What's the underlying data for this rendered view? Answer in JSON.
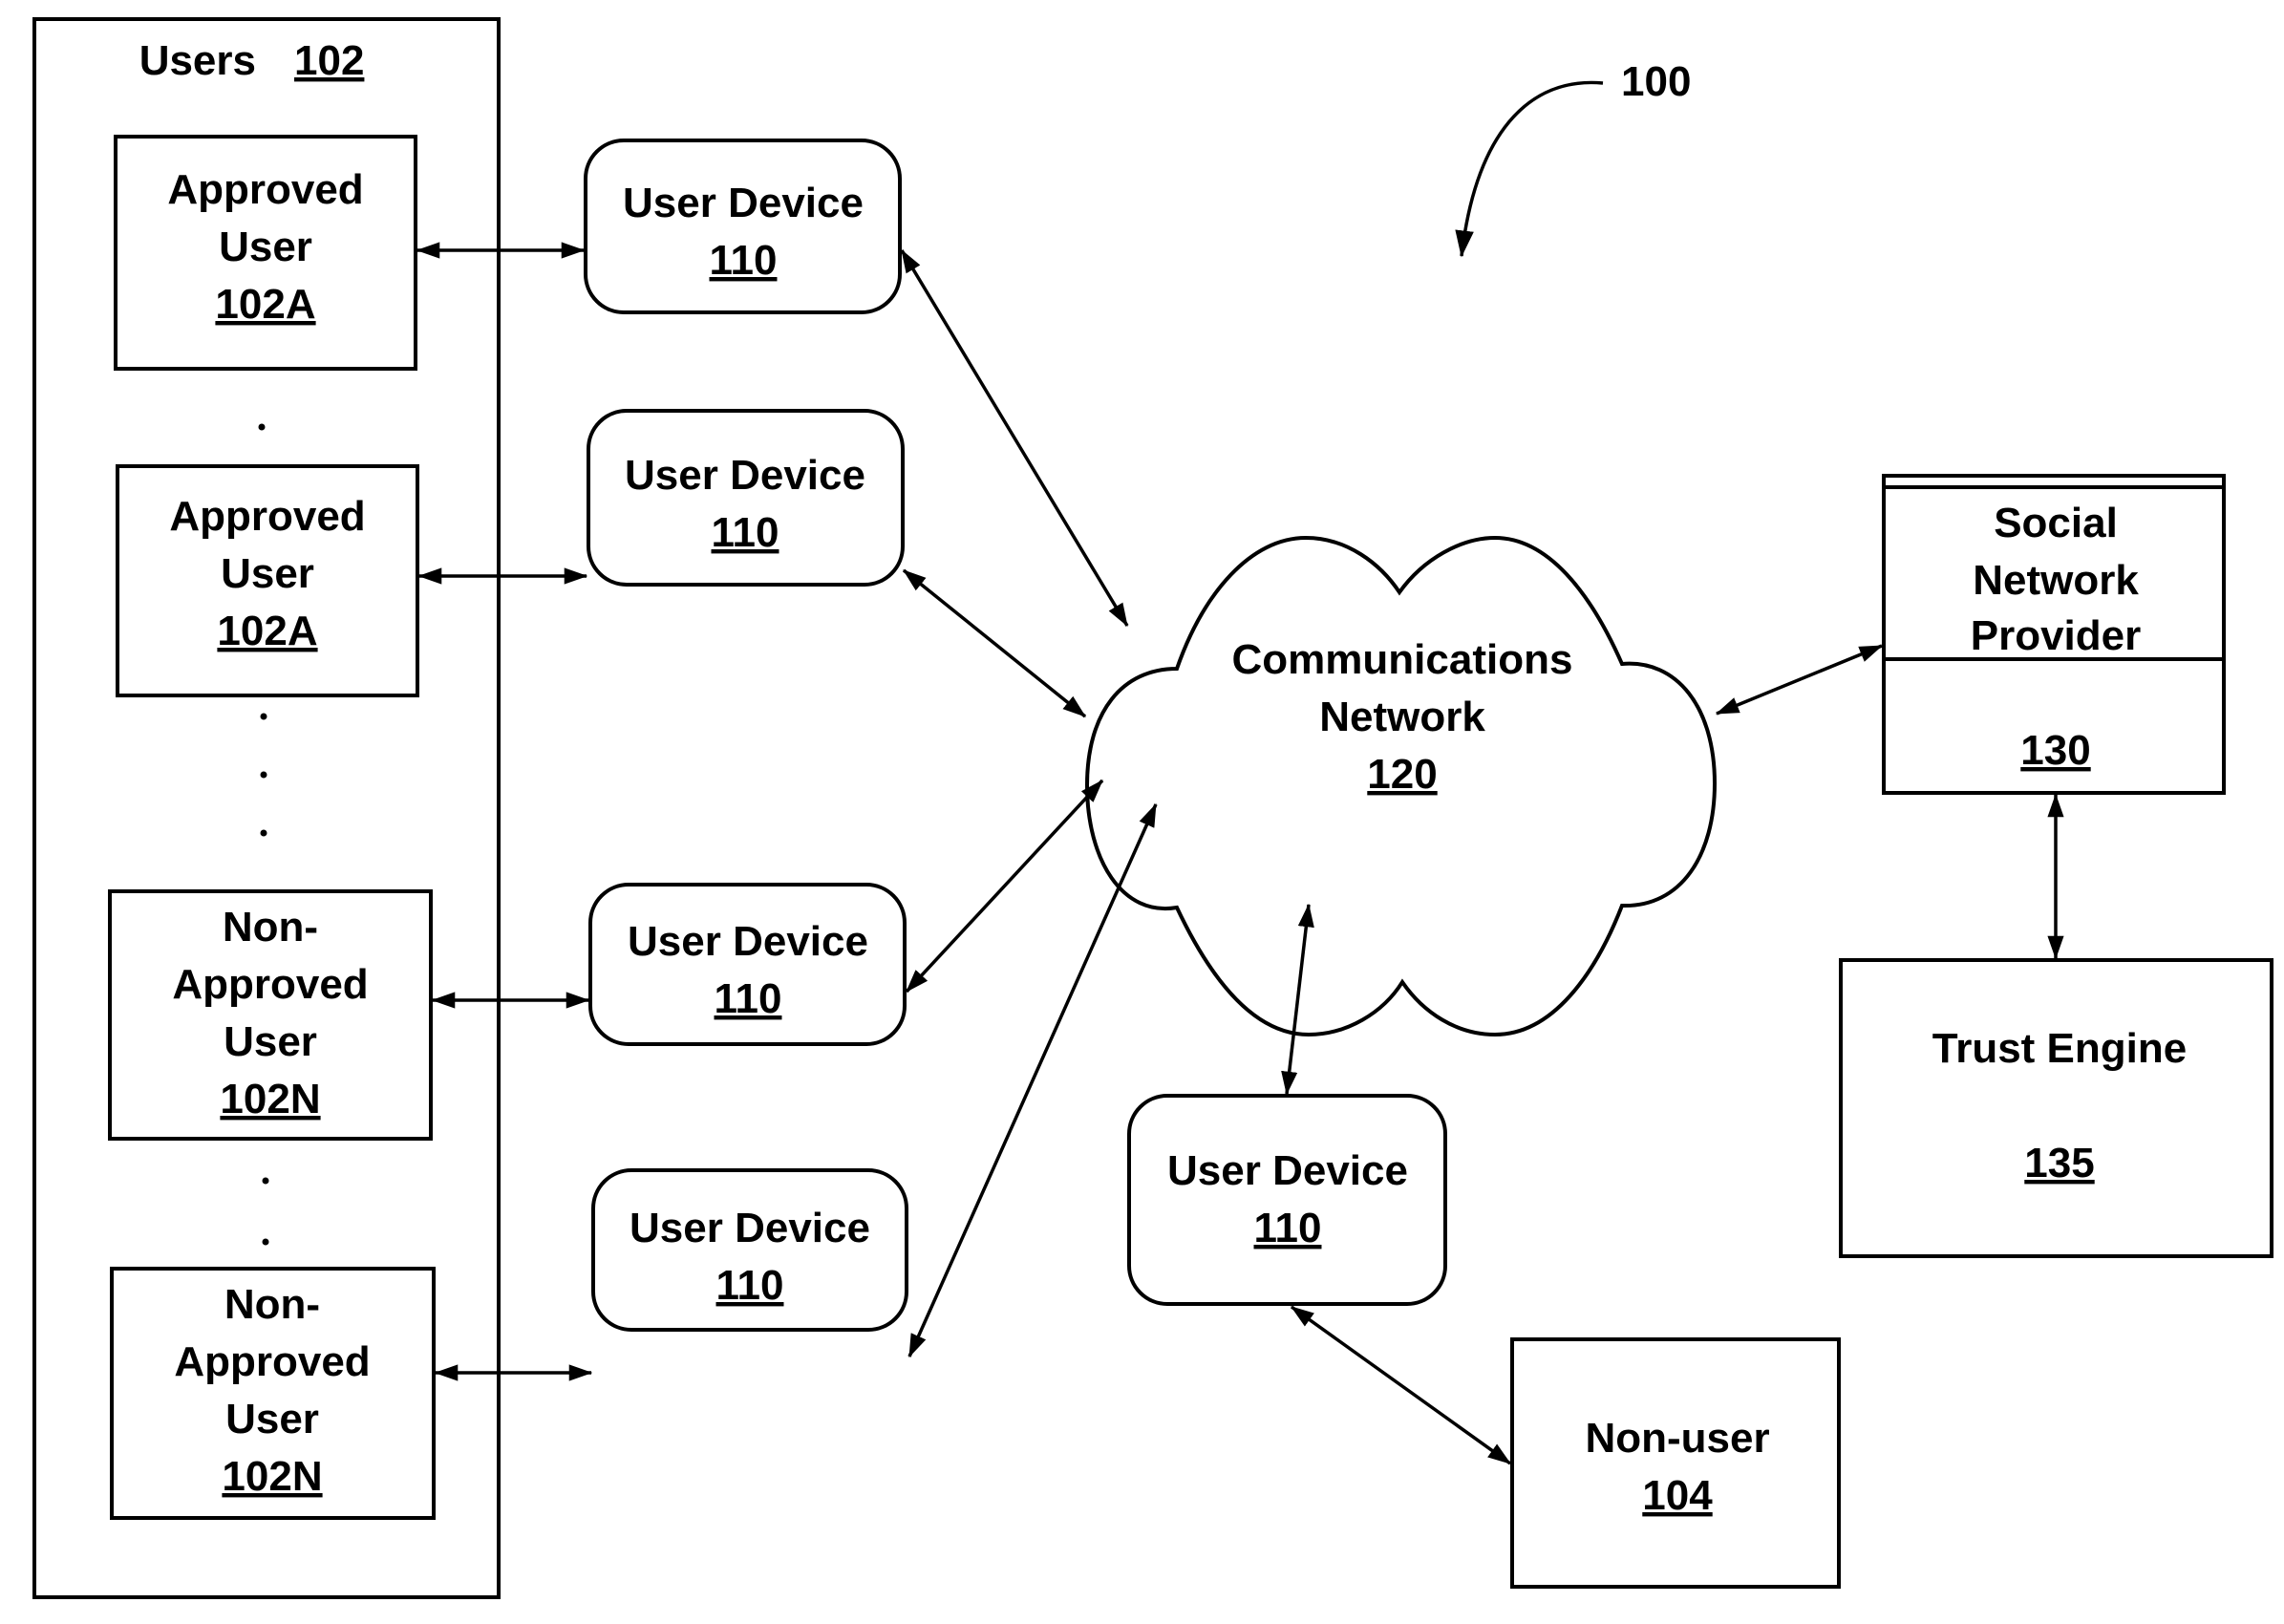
{
  "figure": {
    "reference_number": "100",
    "users_group": {
      "title": "Users",
      "ref": "102"
    },
    "users": [
      {
        "lines": [
          "Approved",
          "User"
        ],
        "ref": "102A"
      },
      {
        "lines": [
          "Approved",
          "User"
        ],
        "ref": "102A"
      },
      {
        "lines": [
          "Non-",
          "Approved",
          "User"
        ],
        "ref": "102N"
      },
      {
        "lines": [
          "Non-",
          "Approved",
          "User"
        ],
        "ref": "102N"
      }
    ],
    "user_devices": [
      {
        "label": "User Device",
        "ref": "110"
      },
      {
        "label": "User Device",
        "ref": "110"
      },
      {
        "label": "User Device",
        "ref": "110"
      },
      {
        "label": "User Device",
        "ref": "110"
      },
      {
        "label": "User Device",
        "ref": "110"
      }
    ],
    "network": {
      "lines": [
        "Communications",
        "Network"
      ],
      "ref": "120"
    },
    "social_network_provider": {
      "lines": [
        "Social",
        "Network",
        "Provider"
      ],
      "ref": "130"
    },
    "trust_engine": {
      "label": "Trust Engine",
      "ref": "135"
    },
    "non_user": {
      "label": "Non-user",
      "ref": "104"
    },
    "connections": [
      {
        "from": "Approved User 102A (1)",
        "to": "User Device 110 (1)",
        "type": "bidirectional"
      },
      {
        "from": "Approved User 102A (2)",
        "to": "User Device 110 (2)",
        "type": "bidirectional"
      },
      {
        "from": "Non-Approved User 102N (1)",
        "to": "User Device 110 (3)",
        "type": "bidirectional"
      },
      {
        "from": "Non-Approved User 102N (2)",
        "to": "User Device 110 (4)",
        "type": "bidirectional"
      },
      {
        "from": "User Device 110 (1)",
        "to": "Communications Network 120",
        "type": "bidirectional"
      },
      {
        "from": "User Device 110 (2)",
        "to": "Communications Network 120",
        "type": "bidirectional"
      },
      {
        "from": "User Device 110 (3)",
        "to": "Communications Network 120",
        "type": "bidirectional"
      },
      {
        "from": "User Device 110 (4)",
        "to": "Communications Network 120",
        "type": "bidirectional"
      },
      {
        "from": "Communications Network 120",
        "to": "User Device 110 (5)",
        "type": "bidirectional"
      },
      {
        "from": "User Device 110 (5)",
        "to": "Non-user 104",
        "type": "bidirectional"
      },
      {
        "from": "Communications Network 120",
        "to": "Social Network Provider 130",
        "type": "bidirectional"
      },
      {
        "from": "Social Network Provider 130",
        "to": "Trust Engine 135",
        "type": "bidirectional"
      }
    ]
  }
}
